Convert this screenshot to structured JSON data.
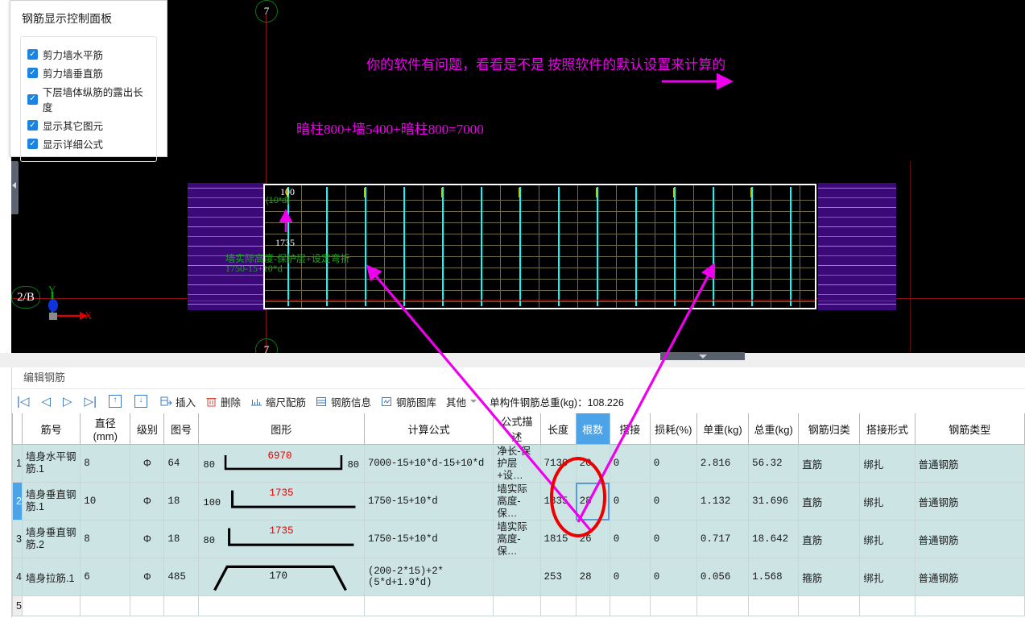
{
  "rebar_panel": {
    "title": "钢筋显示控制面板",
    "options": [
      {
        "label": "剪力墙水平筋",
        "checked": true
      },
      {
        "label": "剪力墙垂直筋",
        "checked": true
      },
      {
        "label": "下层墙体纵筋的露出长度",
        "checked": true
      },
      {
        "label": "显示其它图元",
        "checked": true
      },
      {
        "label": "显示详细公式",
        "checked": true
      }
    ]
  },
  "cad": {
    "annotations": {
      "note1": "你的软件有问题，看看是不是 按照软件的默认设置来计算的",
      "note2": "暗柱800+墙5400+暗柱800=7000"
    },
    "axis_top_label": "7",
    "axis_bottom_label": "7",
    "axis_left_label": "2/B",
    "dim_top": "100",
    "dim_top_sub": "(10*d)",
    "dim_mid": "1735",
    "green_desc": "墙实际高度-保护层+设定弯折",
    "green_formula": "1750-15+10*d",
    "ucs": {
      "x": "X",
      "y": "Y"
    },
    "colors": {
      "background": "#000000",
      "wall_fill": "#3b0a78",
      "annotation": "#ee00ee",
      "rebar_vertical": "#00ffff",
      "formula_text": "#17a81a",
      "axis_line": "#8d0f0f"
    }
  },
  "panel": {
    "title": "编辑钢筋",
    "toolbar": {
      "nav_first": "|◁",
      "nav_prev": "◁",
      "nav_next": "▷",
      "nav_last": "▷|",
      "move_up": "↑",
      "move_down": "↓",
      "insert": "插入",
      "delete": "删除",
      "scale_rebar": "缩尺配筋",
      "rebar_info": "钢筋信息",
      "rebar_library": "钢筋图库",
      "other": "其他",
      "total_weight": "单构件钢筋总重(kg)：108.226"
    }
  },
  "table": {
    "columns": [
      "筋号",
      "直径(mm)",
      "级别",
      "图号",
      "图形",
      "计算公式",
      "公式描述",
      "长度",
      "根数",
      "搭接",
      "损耗(%)",
      "单重(kg)",
      "总重(kg)",
      "钢筋归类",
      "搭接形式",
      "钢筋类型"
    ],
    "selected_column": "根数",
    "rows": [
      {
        "index": "1",
        "name": "墙身水平钢筋.1",
        "diameter": "8",
        "grade": "Φ",
        "drawing_no": "64",
        "shape": {
          "type": "u-bend",
          "left": "80",
          "dim": "6970",
          "right": "80"
        },
        "formula": "7000-15+10*d-15+10*d",
        "formula_desc": "净长-保护层+设…",
        "length": "7130",
        "count": "20",
        "lap": "0",
        "loss": "0",
        "unit_weight": "2.816",
        "total_weight": "56.32",
        "category": "直筋",
        "lap_type": "绑扎",
        "rebar_type": "普通钢筋"
      },
      {
        "index": "2",
        "name": "墙身垂直钢筋.1",
        "diameter": "10",
        "grade": "Φ",
        "drawing_no": "18",
        "shape": {
          "type": "l-bend",
          "left": "100",
          "dim": "1735",
          "right": ""
        },
        "formula": "1750-15+10*d",
        "formula_desc": "墙实际高度-保…",
        "length": "1835",
        "count": "28",
        "lap": "0",
        "loss": "0",
        "unit_weight": "1.132",
        "total_weight": "31.696",
        "category": "直筋",
        "lap_type": "绑扎",
        "rebar_type": "普通钢筋"
      },
      {
        "index": "3",
        "name": "墙身垂直钢筋.2",
        "diameter": "8",
        "grade": "Φ",
        "drawing_no": "18",
        "shape": {
          "type": "l-bend",
          "left": "80",
          "dim": "1735",
          "right": ""
        },
        "formula": "1750-15+10*d",
        "formula_desc": "墙实际高度-保…",
        "length": "1815",
        "count": "26",
        "lap": "0",
        "loss": "0",
        "unit_weight": "0.717",
        "total_weight": "18.642",
        "category": "直筋",
        "lap_type": "绑扎",
        "rebar_type": "普通钢筋"
      },
      {
        "index": "4",
        "name": "墙身拉筋.1",
        "diameter": "6",
        "grade": "Ф",
        "drawing_no": "485",
        "shape": {
          "type": "tie",
          "left": "",
          "dim": "170",
          "right": ""
        },
        "formula": "(200-2*15)+2*(5*d+1.9*d)",
        "formula_desc": "",
        "length": "253",
        "count": "28",
        "lap": "0",
        "loss": "0",
        "unit_weight": "0.056",
        "total_weight": "1.568",
        "category": "箍筋",
        "lap_type": "绑扎",
        "rebar_type": "普通钢筋"
      },
      {
        "index": "5",
        "name": "",
        "diameter": "",
        "grade": "",
        "drawing_no": "",
        "shape": {
          "type": "none",
          "left": "",
          "dim": "",
          "right": ""
        },
        "formula": "",
        "formula_desc": "",
        "length": "",
        "count": "",
        "lap": "",
        "loss": "",
        "unit_weight": "",
        "total_weight": "",
        "category": "",
        "lap_type": "",
        "rebar_type": ""
      }
    ]
  }
}
